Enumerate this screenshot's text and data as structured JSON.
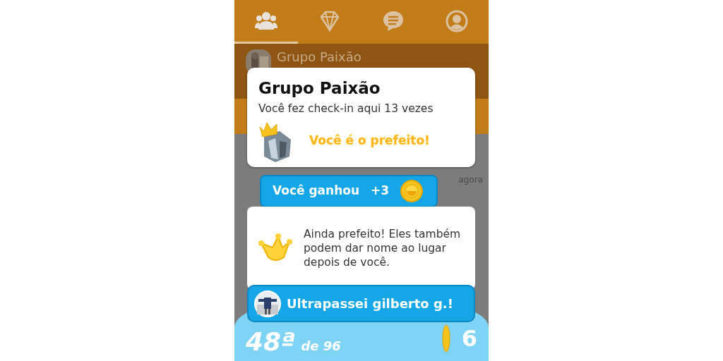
{
  "tabs": [
    {
      "kind": "people",
      "selected": true
    },
    {
      "kind": "diamond",
      "selected": false
    },
    {
      "kind": "chat",
      "selected": false
    },
    {
      "kind": "profile",
      "selected": false
    }
  ],
  "venue_header": {
    "name": "Grupo Paixão"
  },
  "list": {
    "time": "agora"
  },
  "popup": {
    "title": "Grupo Paixão",
    "checkins": "Você fez check-in aqui 13 vezes",
    "mayor": "Você é o prefeito!"
  },
  "reward": {
    "label": "Você ganhou",
    "amount": "+3"
  },
  "message": {
    "text": "Ainda prefeito! Eles também podem dar nome ao lugar depois de você."
  },
  "overtake": {
    "text": "Ultrapassei gilberto g.!"
  },
  "footer": {
    "rank": "48ª",
    "rank_total": "de 96",
    "coins": "6"
  }
}
